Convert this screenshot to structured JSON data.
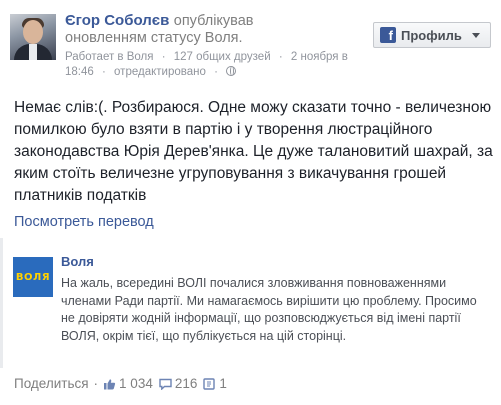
{
  "author": {
    "name": "Єгор Соболєв",
    "action": "опублікував",
    "status_text": "оновленням статусу Воля."
  },
  "meta": {
    "work": "Работает в Воля",
    "mutual_friends": "127 общих друзей",
    "date": "2 ноября в 18:46",
    "edited": "отредактировано"
  },
  "profile_button": {
    "label": "Профиль",
    "fb_letter": "f"
  },
  "post": {
    "text": "Немає слів:(. Розбираюся. Одне можу сказати точно - величезною помилкою було взяти в партію і у творення люстраційного законодавства Юрія Дерев'янка. Це дуже талановитий шахрай, за яким стоїть величезне угруповування з викачування грошей платників податків"
  },
  "translate_link": "Посмотреть перевод",
  "shared_post": {
    "page_name": "Воля",
    "logo_text": "ВОЛЯ",
    "text": "На жаль, всередині ВОЛІ почалися зловживання повноваженнями членами Ради партії. Ми намагаємось вирішити цю проблему. Просимо не довіряти жодній інформації, що розповсюджується від імені партії ВОЛЯ, окрім тієї, що публікується на цій сторінці."
  },
  "footer": {
    "share_label": "Поделиться",
    "likes": "1 034",
    "comments": "216",
    "reshares": "1"
  },
  "colors": {
    "link": "#3b5998",
    "muted": "#90949c",
    "logo_bg": "#2a6bbd",
    "logo_text": "#ffd200"
  }
}
